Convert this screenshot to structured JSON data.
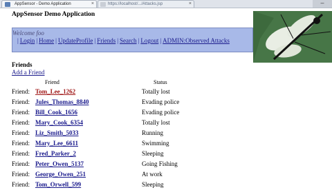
{
  "browser": {
    "tab1_title": "AppSensor - Demo Application",
    "tab1_close": "×",
    "tab2_url": "https://localhost/.../Attacks.jsp",
    "tab2_close": "×",
    "window_button": "–"
  },
  "app": {
    "title": "AppSensor Demo Application"
  },
  "nav": {
    "welcome": "Welcome foo",
    "separator": "|",
    "links": [
      "Login",
      "Home",
      "UpdateProfile",
      "Friends",
      "Search",
      "Logout",
      "ADMIN:Observed Attacks"
    ]
  },
  "friends": {
    "heading": "Friends",
    "add_link": "Add a Friend",
    "col_friend": "Friend",
    "col_status": "Status",
    "row_label": "Friend:",
    "rows": [
      {
        "name": "Tom_Lee_1262",
        "status": "Totally lost"
      },
      {
        "name": "Jules_Thomas_8840",
        "status": "Evading police"
      },
      {
        "name": "Bill_Cook_1656",
        "status": "Evading police"
      },
      {
        "name": "Mary_Cook_6354",
        "status": "Totally lost"
      },
      {
        "name": "Liz_Smith_5033",
        "status": "Running"
      },
      {
        "name": "Mary_Lee_6611",
        "status": "Swimming"
      },
      {
        "name": "Fred_Parker_2",
        "status": "Sleeping"
      },
      {
        "name": "Peter_Owen_5137",
        "status": "Going Fishing"
      },
      {
        "name": "George_Owen_251",
        "status": "At work"
      },
      {
        "name": "Tom_Orwell_599",
        "status": "Sleeping"
      }
    ]
  },
  "colors": {
    "nav_background": "#a8b9e8",
    "link": "#1a1a8c",
    "visited_link": "#a01818",
    "banner_background": "#3d6a3d"
  }
}
